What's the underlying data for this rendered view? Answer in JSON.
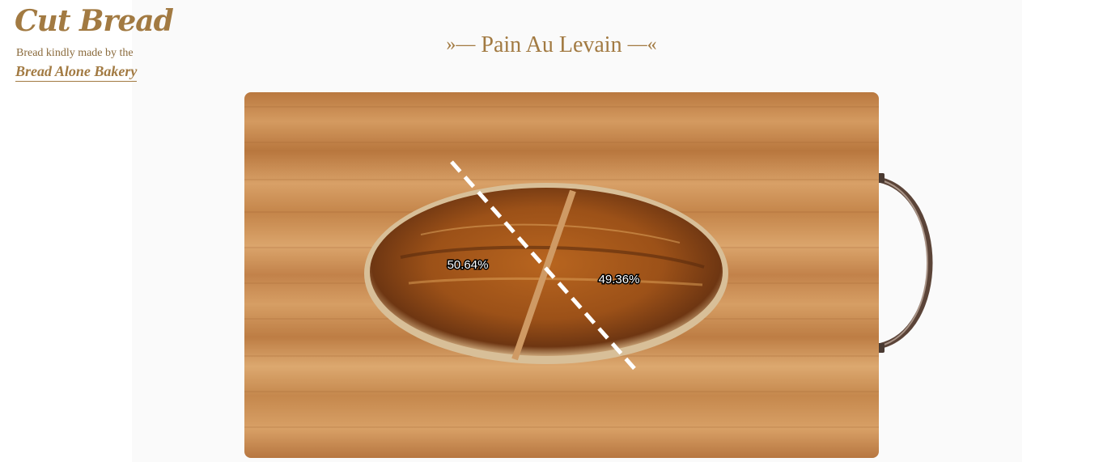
{
  "brand": {
    "title": "Cut Bread",
    "subtitle": "Bread kindly made by the",
    "link_label": "Bread Alone Bakery"
  },
  "page": {
    "ornament_left": "»—",
    "title": "Pain Au Levain",
    "ornament_right": "—«"
  },
  "cut": {
    "left_share": "50.64%",
    "right_share": "49.36%"
  },
  "colors": {
    "brand": "#a27a42",
    "board": "#c68a4f",
    "crust": "#8a4a1c",
    "cut_line": "#ffffff"
  }
}
